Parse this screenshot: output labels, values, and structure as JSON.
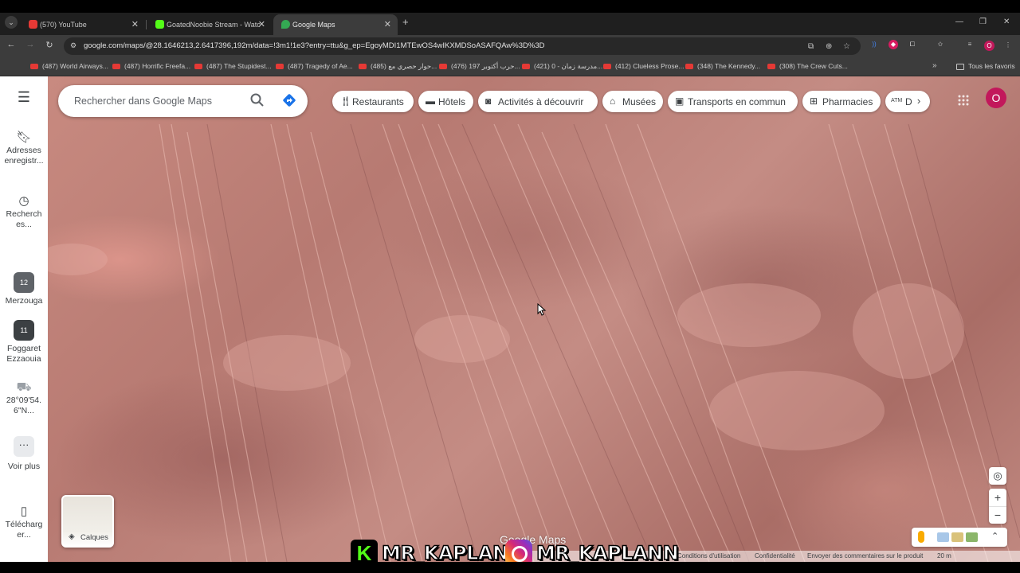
{
  "browser": {
    "tabs": [
      {
        "title": "(570) YouTube",
        "favicon_color": "#e53935"
      },
      {
        "title": "GoatedNoobie Stream - Watch",
        "favicon_color": "#53fc18"
      },
      {
        "title": "Google Maps",
        "favicon_color": "#34a853"
      }
    ],
    "new_tab": "+",
    "url": "google.com/maps/@28.1646213,2.6417396,192m/data=!3m1!1e3?entry=ttu&g_ep=EgoyMDI1MTEwOS4wIKXMDSoASAFQAw%3D%3D",
    "profile_initial": "O",
    "bookmarks": [
      "(487) World Airways...",
      "(487) Horrific Freefa...",
      "(487) The Stupidest...",
      "(487) Tragedy of Ae...",
      "(485) حوار حصري مع...",
      "(476) حرب أكتوبر 197...",
      "(421) مدرسة زمان - 0...",
      "(412) Clueless Prose...",
      "(348) The Kennedy...",
      "(308) The Crew Cuts..."
    ],
    "bookmarks_folder": "Tous les favoris"
  },
  "sidebar": {
    "items": [
      {
        "label": "Adresses enregistr...",
        "icon": "bookmark-icon"
      },
      {
        "label": "Recherch es...",
        "icon": "history-icon"
      },
      {
        "label": "Merzouga",
        "icon": "recent-place-thumb",
        "badge": "12"
      },
      {
        "label": "Foggaret Ezzaouia",
        "icon": "recent-place-thumb",
        "badge": "11"
      },
      {
        "label": "28°09'54. 6\"N...",
        "icon": "pin-thumb"
      },
      {
        "label": "Voir plus",
        "icon": "more-icon"
      },
      {
        "label": "Télécharg er...",
        "icon": "phone-icon"
      }
    ]
  },
  "search": {
    "placeholder": "Rechercher dans Google Maps"
  },
  "categories": [
    {
      "label": "Restaurants",
      "icon": "restaurant-icon"
    },
    {
      "label": "Hôtels",
      "icon": "hotel-icon"
    },
    {
      "label": "Activités à découvrir",
      "icon": "camera-icon"
    },
    {
      "label": "Musées",
      "icon": "museum-icon"
    },
    {
      "label": "Transports en commun",
      "icon": "transit-icon"
    },
    {
      "label": "Pharmacies",
      "icon": "pharmacy-icon"
    },
    {
      "label": "D",
      "icon": "atm-icon",
      "icon_text": "ATM"
    }
  ],
  "account_initial": "O",
  "map": {
    "layers_label": "Calques",
    "watermark": "Google Maps",
    "attribution": [
      "Conditions d'utilisation",
      "Confidentialité",
      "Envoyer des commentaires sur le produit"
    ],
    "scale": "20 m",
    "zoom_in": "+",
    "zoom_out": "−"
  },
  "overlay": {
    "kick_handle": "MR_KAPLANN",
    "instagram_handle": "MR_KAPLANN",
    "kick_letter": "K"
  },
  "colors": {
    "accent_avatar": "#c2185b",
    "terrain": "#c08880"
  }
}
